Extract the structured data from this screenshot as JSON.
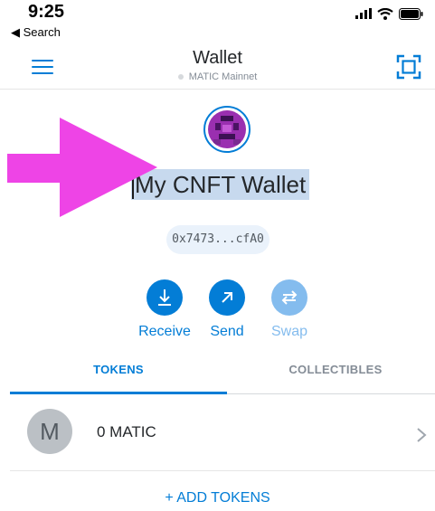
{
  "status_bar": {
    "time": "9:25",
    "back_label": "◀ Search",
    "icons": [
      "signal-icon",
      "wifi-icon",
      "battery-icon"
    ]
  },
  "nav": {
    "title": "Wallet",
    "network": "MATIC Mainnet",
    "menu_icon": "menu-icon",
    "scan_icon": "scan-qr-icon"
  },
  "account": {
    "name": "My CNFT Wallet",
    "address": "0x7473...cfA0",
    "avatar_icon": "identicon"
  },
  "actions": [
    {
      "label": "Receive",
      "icon": "download-icon",
      "enabled": true
    },
    {
      "label": "Send",
      "icon": "arrow-up-right-icon",
      "enabled": true
    },
    {
      "label": "Swap",
      "icon": "swap-icon",
      "enabled": false
    }
  ],
  "tabs": [
    {
      "label": "TOKENS",
      "active": true
    },
    {
      "label": "COLLECTIBLES",
      "active": false
    }
  ],
  "tokens": [
    {
      "avatar_letter": "M",
      "balance": "0 MATIC"
    }
  ],
  "add_tokens_label": "+ ADD TOKENS",
  "colors": {
    "accent": "#037dd6",
    "accent_disabled": "#84bcee",
    "annotation_arrow": "#ee44e6",
    "selection_highlight": "#c7d9ee"
  }
}
